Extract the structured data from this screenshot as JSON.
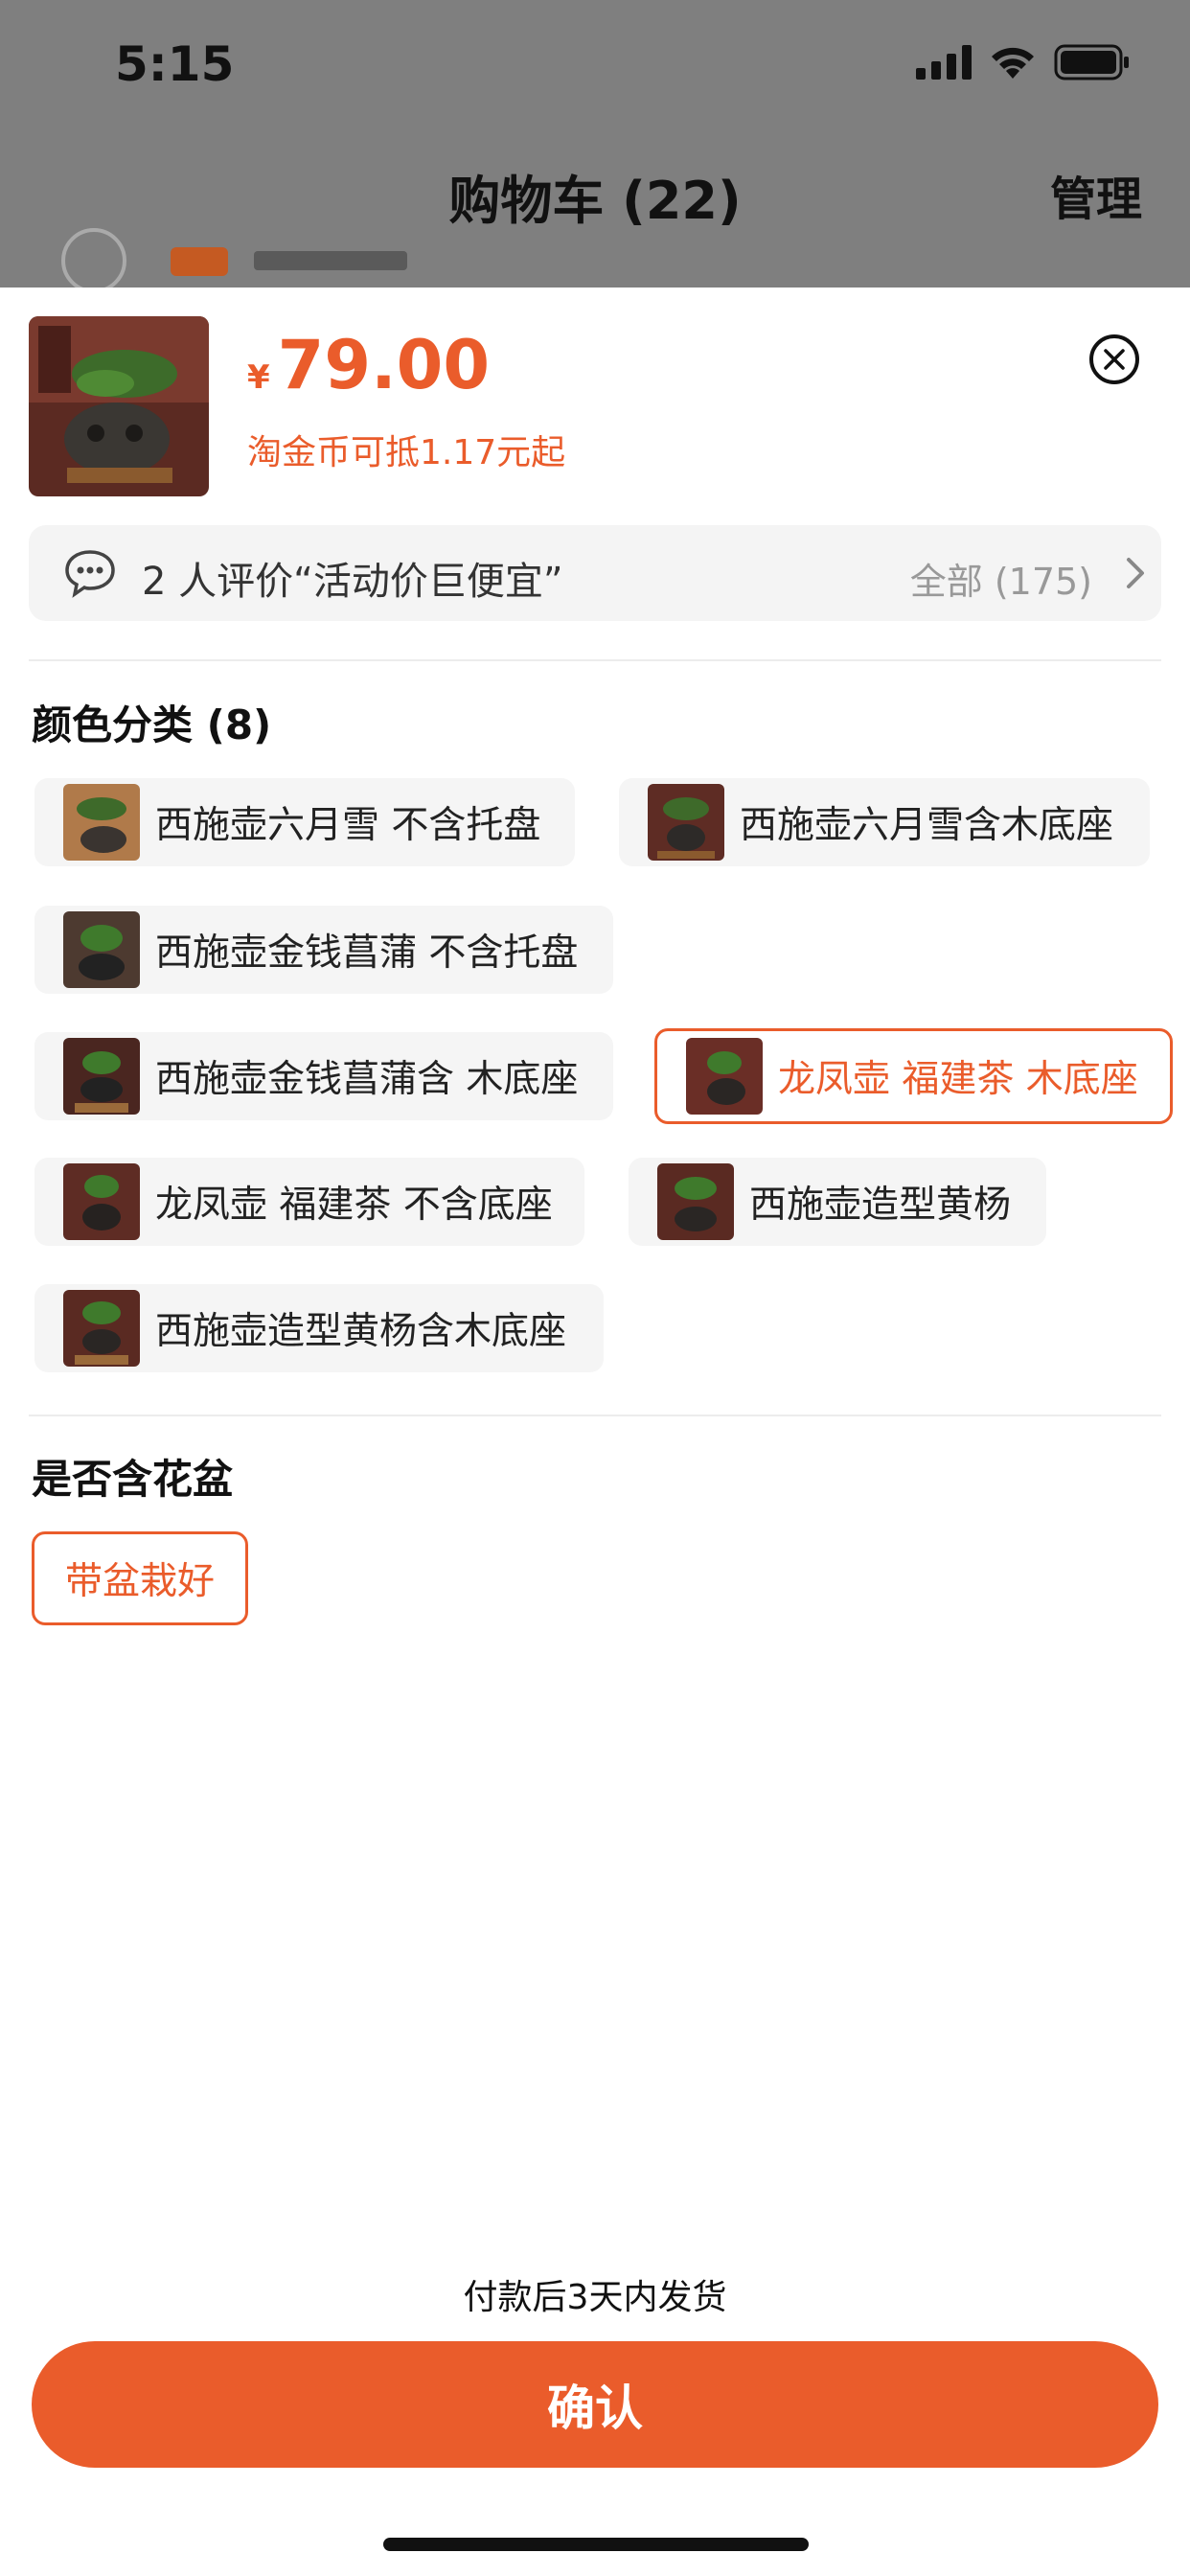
{
  "status_bar": {
    "time": "5:15",
    "icons": [
      "cellular-signal-icon",
      "wifi-icon",
      "battery-icon"
    ]
  },
  "cart_header": {
    "title": "购物车 (22)",
    "manage_label": "管理"
  },
  "product": {
    "currency": "¥",
    "price": "79.00",
    "coin_text": "淘金币可抵1.17元起"
  },
  "review": {
    "text": "2 人评价“活动价巨便宜”",
    "all_label": "全部 (175)"
  },
  "color_section": {
    "title": "颜色分类 (8)",
    "options": [
      {
        "label": "西施壶六月雪 不含托盘",
        "selected": false
      },
      {
        "label": "西施壶六月雪含木底座",
        "selected": false
      },
      {
        "label": "西施壶金钱菖蒲 不含托盘",
        "selected": false
      },
      {
        "label": "西施壶金钱菖蒲含 木底座",
        "selected": false
      },
      {
        "label": "龙凤壶 福建茶 木底座",
        "selected": true
      },
      {
        "label": "龙凤壶 福建茶 不含底座",
        "selected": false
      },
      {
        "label": "西施壶造型黄杨",
        "selected": false
      },
      {
        "label": "西施壶造型黄杨含木底座",
        "selected": false
      }
    ]
  },
  "pot_section": {
    "title": "是否含花盆",
    "options": [
      {
        "label": "带盆栽好",
        "selected": true
      }
    ]
  },
  "footer": {
    "shipping_note": "付款后3天内发货",
    "confirm_label": "确认"
  },
  "colors": {
    "accent": "#ea5c2b",
    "chip_bg": "#f5f5f5",
    "backdrop": "#7f7f7f"
  }
}
